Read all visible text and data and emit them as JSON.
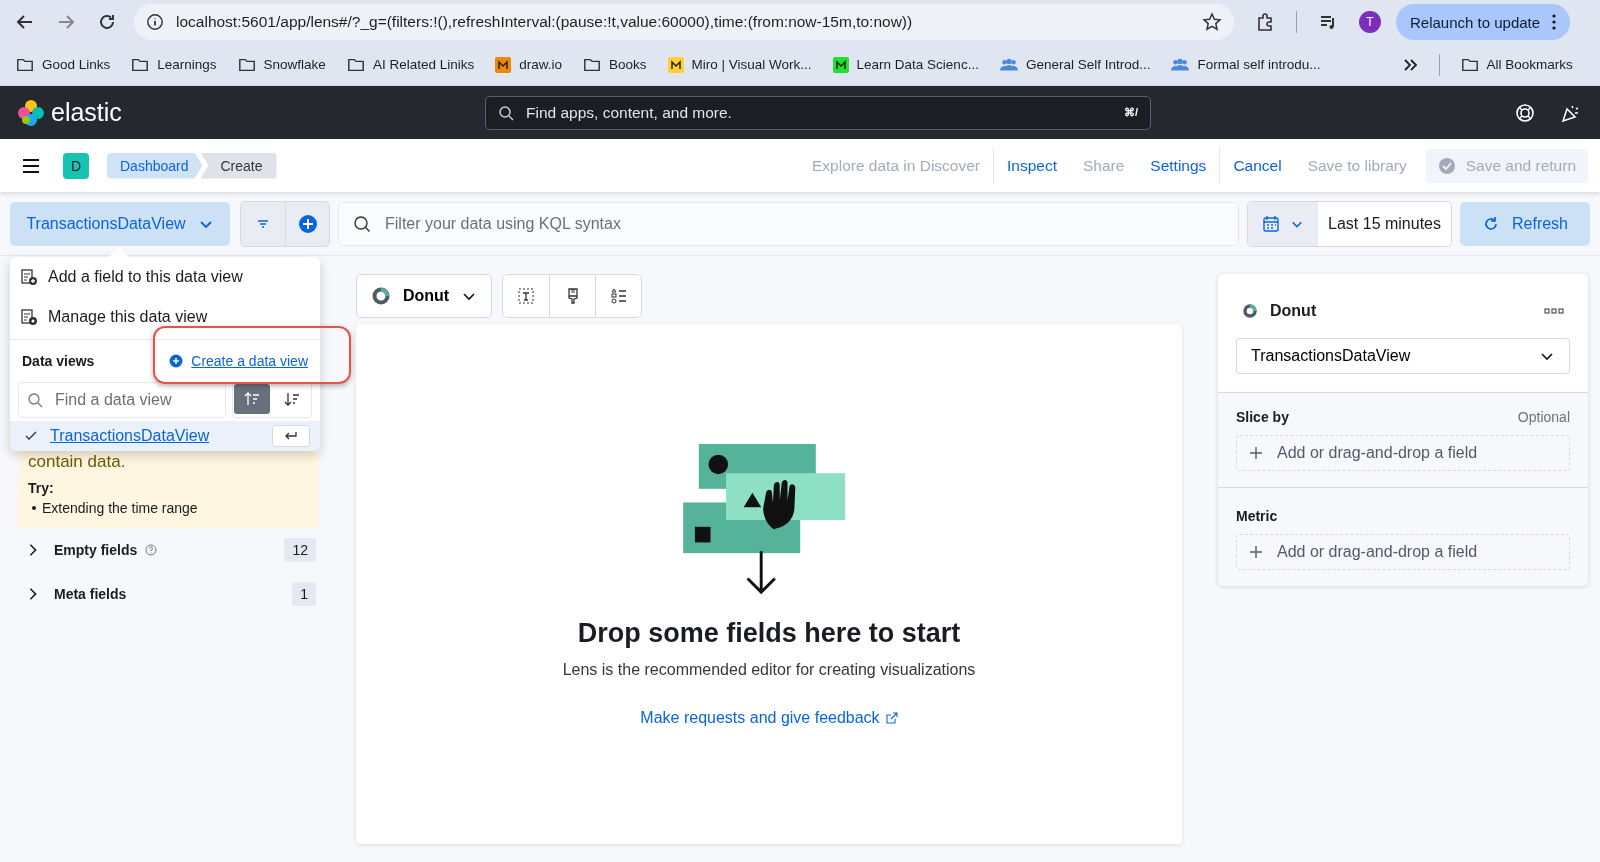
{
  "browser": {
    "url": "localhost:5601/app/lens#/?_g=(filters:!(),refreshInterval:(pause:!t,value:60000),time:(from:now-15m,to:now))",
    "profile_initial": "T",
    "relaunch": "Relaunch to update",
    "bookmarks": [
      {
        "label": "Good Links",
        "kind": "folder"
      },
      {
        "label": "Learnings",
        "kind": "folder"
      },
      {
        "label": "Snowflake",
        "kind": "folder"
      },
      {
        "label": "AI Related Liniks",
        "kind": "folder"
      },
      {
        "label": "draw.io",
        "kind": "site",
        "color": "#f08705"
      },
      {
        "label": "Books",
        "kind": "folder"
      },
      {
        "label": "Miro | Visual Work...",
        "kind": "site",
        "color": "#ffd02f"
      },
      {
        "label": "Learn Data Scienc...",
        "kind": "site",
        "color": "#20e030"
      },
      {
        "label": "General Self Introd...",
        "kind": "people"
      },
      {
        "label": "Formal self introdu...",
        "kind": "people"
      }
    ],
    "all_bookmarks": "All Bookmarks"
  },
  "kibana_header": {
    "logo_text": "elastic",
    "search_placeholder": "Find apps, content, and more.",
    "shortcut": "⌘/"
  },
  "app_header": {
    "space_initial": "D",
    "breadcrumbs": [
      {
        "label": "Dashboard",
        "current": false
      },
      {
        "label": "Create",
        "current": true
      }
    ],
    "actions": [
      {
        "label": "Explore data in Discover",
        "disabled": true,
        "separator_after": true
      },
      {
        "label": "Inspect",
        "disabled": false,
        "separator_after": false
      },
      {
        "label": "Share",
        "disabled": true,
        "separator_after": false
      },
      {
        "label": "Settings",
        "disabled": false,
        "separator_after": true
      },
      {
        "label": "Cancel",
        "disabled": false,
        "separator_after": false
      },
      {
        "label": "Save to library",
        "disabled": true,
        "separator_after": false
      }
    ],
    "save_button": {
      "label": "Save and return",
      "disabled": true
    }
  },
  "query_bar": {
    "data_view": "TransactionsDataView",
    "placeholder": "Filter your data using KQL syntax",
    "time_range": "Last 15 minutes",
    "refresh": "Refresh"
  },
  "popover": {
    "menu_items": [
      {
        "label": "Add a field to this data view",
        "kind": "add"
      },
      {
        "label": "Manage this data view",
        "kind": "manage"
      }
    ],
    "section_title": "Data views",
    "create_link": {
      "label": "Create a data view",
      "highlighted": true
    },
    "search_placeholder": "Find a data view",
    "sort_buttons": [
      {
        "kind": "asc",
        "selected": true
      },
      {
        "kind": "desc",
        "selected": false
      }
    ],
    "items": [
      {
        "label": "TransactionsDataView",
        "selected": true
      }
    ]
  },
  "sidebar": {
    "callout": {
      "text": "contain data.",
      "try_label": "Try:",
      "suggestions": [
        "Extending the time range"
      ]
    },
    "groups": [
      {
        "label": "Empty fields",
        "count": "12",
        "help": true
      },
      {
        "label": "Meta fields",
        "count": "1",
        "help": false
      }
    ]
  },
  "workspace": {
    "chart_type": "Donut",
    "empty_title": "Drop some fields here to start",
    "empty_text": "Lens is the recommended editor for creating visualizations",
    "feedback_link": "Make requests and give feedback"
  },
  "config_panel": {
    "chart_type": "Donut",
    "data_view": "TransactionsDataView",
    "sections": [
      {
        "label": "Slice by",
        "note": "Optional",
        "placeholder": "Add or drag-and-drop a field"
      },
      {
        "label": "Metric",
        "placeholder": "Add or drag-and-drop a field"
      }
    ]
  }
}
